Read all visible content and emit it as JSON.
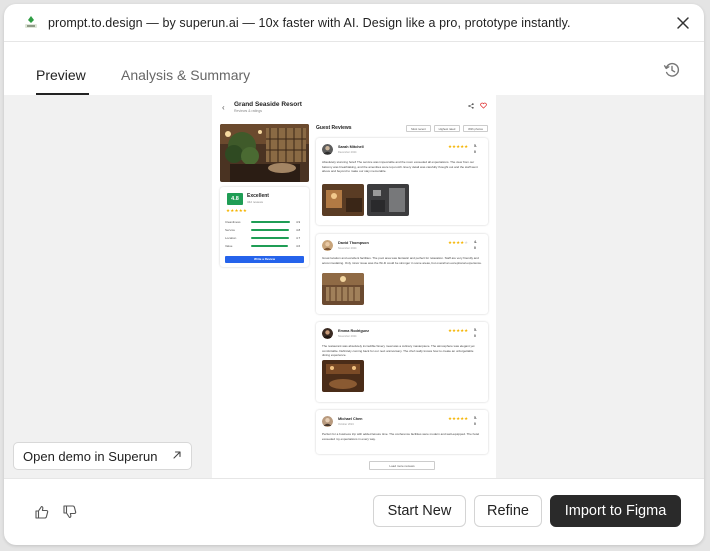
{
  "window": {
    "title": "prompt.to.design — by superun.ai — 10x faster with AI. Design like a pro, prototype instantly."
  },
  "tabs": [
    {
      "label": "Preview",
      "active": true
    },
    {
      "label": "Analysis & Summary",
      "active": false
    }
  ],
  "preview": {
    "hotel_name": "Grand Seaside Resort",
    "hotel_subtitle": "Reviews & ratings",
    "rating": {
      "score": "4.8",
      "label": "Excellent",
      "review_count": "342 reviews",
      "stars": 5,
      "categories": [
        {
          "name": "Cleanliness",
          "value": "4.9",
          "fill": 0.98
        },
        {
          "name": "Service",
          "value": "4.8",
          "fill": 0.96
        },
        {
          "name": "Location",
          "value": "4.7",
          "fill": 0.94
        },
        {
          "name": "Value",
          "value": "4.6",
          "fill": 0.92
        }
      ],
      "write_button": "Write a Review"
    },
    "reviews_heading": "Guest Reviews",
    "filters": [
      "Most recent",
      "Highest rated",
      "With photos"
    ],
    "reviews": [
      {
        "name": "Sarah Mitchell",
        "date": "December 2024",
        "stars": 5,
        "score": "5.",
        "score2": "0",
        "text": "Absolutely stunning hotel! The service was impeccable and the room exceeded all expectations. The view from our balcony was breathtaking, and the amenities were top-notch. Every detail was carefully thought out and the staff went above and beyond to make our stay memorable."
      },
      {
        "name": "David Thompson",
        "date": "November 2024",
        "stars": 4,
        "score": "4.",
        "score2": "0",
        "text": "Great location and excellent facilities. The pool area was fantastic and perfect for relaxation. Staff are very friendly and accommodating. Only minor issue was the Wi-Fi could be stronger in some areas, but overall an exceptional experience."
      },
      {
        "name": "Emma Rodriguez",
        "date": "November 2024",
        "stars": 5,
        "score": "5.",
        "score2": "0",
        "text": "The restaurant was absolutely incredible! Every meal was a culinary masterpiece. The atmosphere was elegant yet comfortable. Definitely coming back for our next anniversary. The chef really knows how to create an unforgettable dining experience."
      },
      {
        "name": "Michael Chen",
        "date": "October 2024",
        "stars": 5,
        "score": "5.",
        "score2": "0",
        "text": "Perfect for a business trip with added leisure time. The conference facilities were modern and well-equipped. The hotel exceeded my expectations in every way."
      }
    ],
    "load_more": "Load more reviews"
  },
  "open_demo": "Open demo in Superun",
  "buttons": {
    "start_new": "Start New",
    "refine": "Refine",
    "import": "Import to Figma"
  },
  "icons": [
    "superun-logo-icon",
    "close-icon",
    "history-icon",
    "external-link-icon",
    "thumbs-up-icon",
    "thumbs-down-icon"
  ],
  "colors": {
    "primary_dark": "#2a2a2a",
    "rating_green": "#1f9d55",
    "star_gold": "#f5b400",
    "cta_blue": "#2563eb"
  }
}
